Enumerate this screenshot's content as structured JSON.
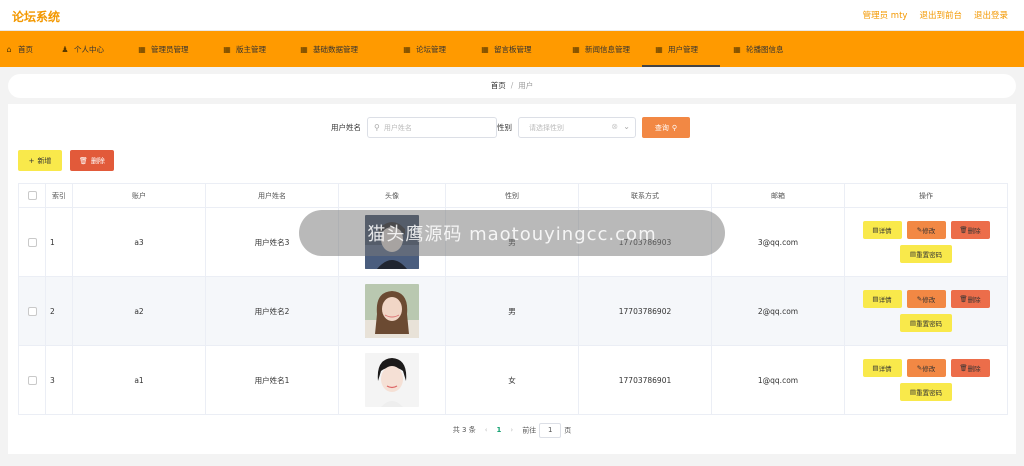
{
  "header": {
    "title": "论坛系统",
    "links": [
      "管理员 mty",
      "退出到前台",
      "退出登录"
    ]
  },
  "nav": {
    "items": [
      {
        "label": "首页",
        "icon": "home-icon"
      },
      {
        "label": "个人中心",
        "icon": "user-icon"
      },
      {
        "label": "管理员管理",
        "icon": "grid-icon"
      },
      {
        "label": "版主管理",
        "icon": "grid-icon"
      },
      {
        "label": "基础数据管理",
        "icon": "grid-icon"
      },
      {
        "label": "论坛管理",
        "icon": "grid-icon"
      },
      {
        "label": "留言板管理",
        "icon": "grid-icon"
      },
      {
        "label": "新闻信息管理",
        "icon": "grid-icon"
      },
      {
        "label": "用户管理",
        "icon": "grid-icon"
      },
      {
        "label": "轮播图信息",
        "icon": "grid-icon"
      }
    ],
    "active_index": 8
  },
  "breadcrumb": {
    "home": "首页",
    "separator": "/",
    "current": "用户"
  },
  "search": {
    "name_label": "用户姓名",
    "name_placeholder": "用户姓名",
    "gender_label": "性别",
    "gender_placeholder": "请选择性别",
    "query_label": "查询"
  },
  "actions": {
    "add_label": "新增",
    "delete_label": "删除"
  },
  "table": {
    "headers": [
      "索引",
      "账户",
      "用户姓名",
      "头像",
      "性别",
      "联系方式",
      "邮箱",
      "操作"
    ],
    "rows": [
      {
        "index": "1",
        "account": "a3",
        "name": "用户姓名3",
        "gender": "男",
        "phone": "17703786903",
        "email": "3@qq.com"
      },
      {
        "index": "2",
        "account": "a2",
        "name": "用户姓名2",
        "gender": "男",
        "phone": "17703786902",
        "email": "2@qq.com"
      },
      {
        "index": "3",
        "account": "a1",
        "name": "用户姓名1",
        "gender": "女",
        "phone": "17703786901",
        "email": "1@qq.com"
      }
    ],
    "ops": {
      "detail": "详情",
      "edit": "修改",
      "delete": "删除",
      "reset": "重置密码"
    }
  },
  "pagination": {
    "total": "共 3 条",
    "prev": "‹",
    "page": "1",
    "next": "›",
    "goto": "前往",
    "goto_value": "1",
    "page_unit": "页"
  },
  "watermark": "猫头鹰源码 maotouyingcc.com",
  "colors": {
    "accent": "#ff9a00",
    "brand": "#f39800",
    "query_btn": "#f28844",
    "add_btn": "#f9e94b",
    "del_btn": "#e25a3a"
  }
}
